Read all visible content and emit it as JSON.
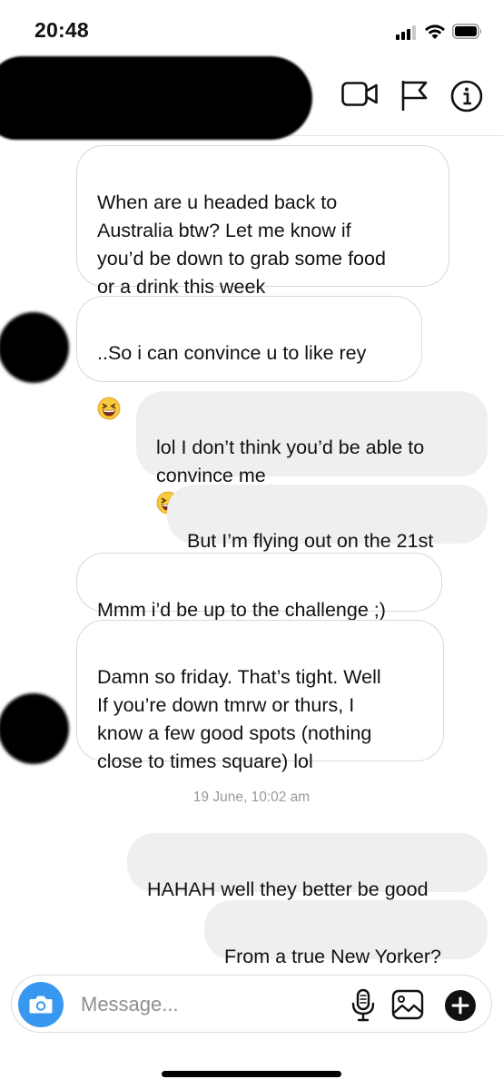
{
  "status_bar": {
    "time": "20:48"
  },
  "header": {
    "icons": [
      "video-camera-icon",
      "flag-icon",
      "info-icon"
    ]
  },
  "messages": [
    {
      "side": "received",
      "text": "When are u headed back to\nAustralia btw? Let me know if\nyou’d be down to grab some food\nor a drink this week"
    },
    {
      "side": "received",
      "text": "..So i can convince u to like rey",
      "emoji": "grinning-squinting-face"
    },
    {
      "side": "sent",
      "text": "lol I don’t think you’d be able to\nconvince me",
      "emoji": "grinning-squinting-face"
    },
    {
      "side": "sent",
      "text": "But I’m flying out on the 21st"
    },
    {
      "side": "received",
      "text": "Mmm i’d be up to the challenge ;)"
    },
    {
      "side": "received",
      "text": "Damn so friday. That’s tight. Well\nIf you’re down tmrw or thurs, I\nknow a few good spots (nothing\nclose to times square) lol"
    },
    {
      "side": "sent",
      "text": "HAHAH well they better be good"
    },
    {
      "side": "sent",
      "text": "From a true New Yorker?"
    }
  ],
  "timestamp": "19 June, 10:02 am",
  "composer": {
    "placeholder": "Message...",
    "icons": [
      "camera-icon",
      "microphone-icon",
      "gallery-icon",
      "plus-icon"
    ]
  },
  "colors": {
    "accent": "#3897f0",
    "sent_bubble": "#efefef",
    "received_border": "#d9d9d9",
    "timestamp": "#9a9a9a"
  }
}
